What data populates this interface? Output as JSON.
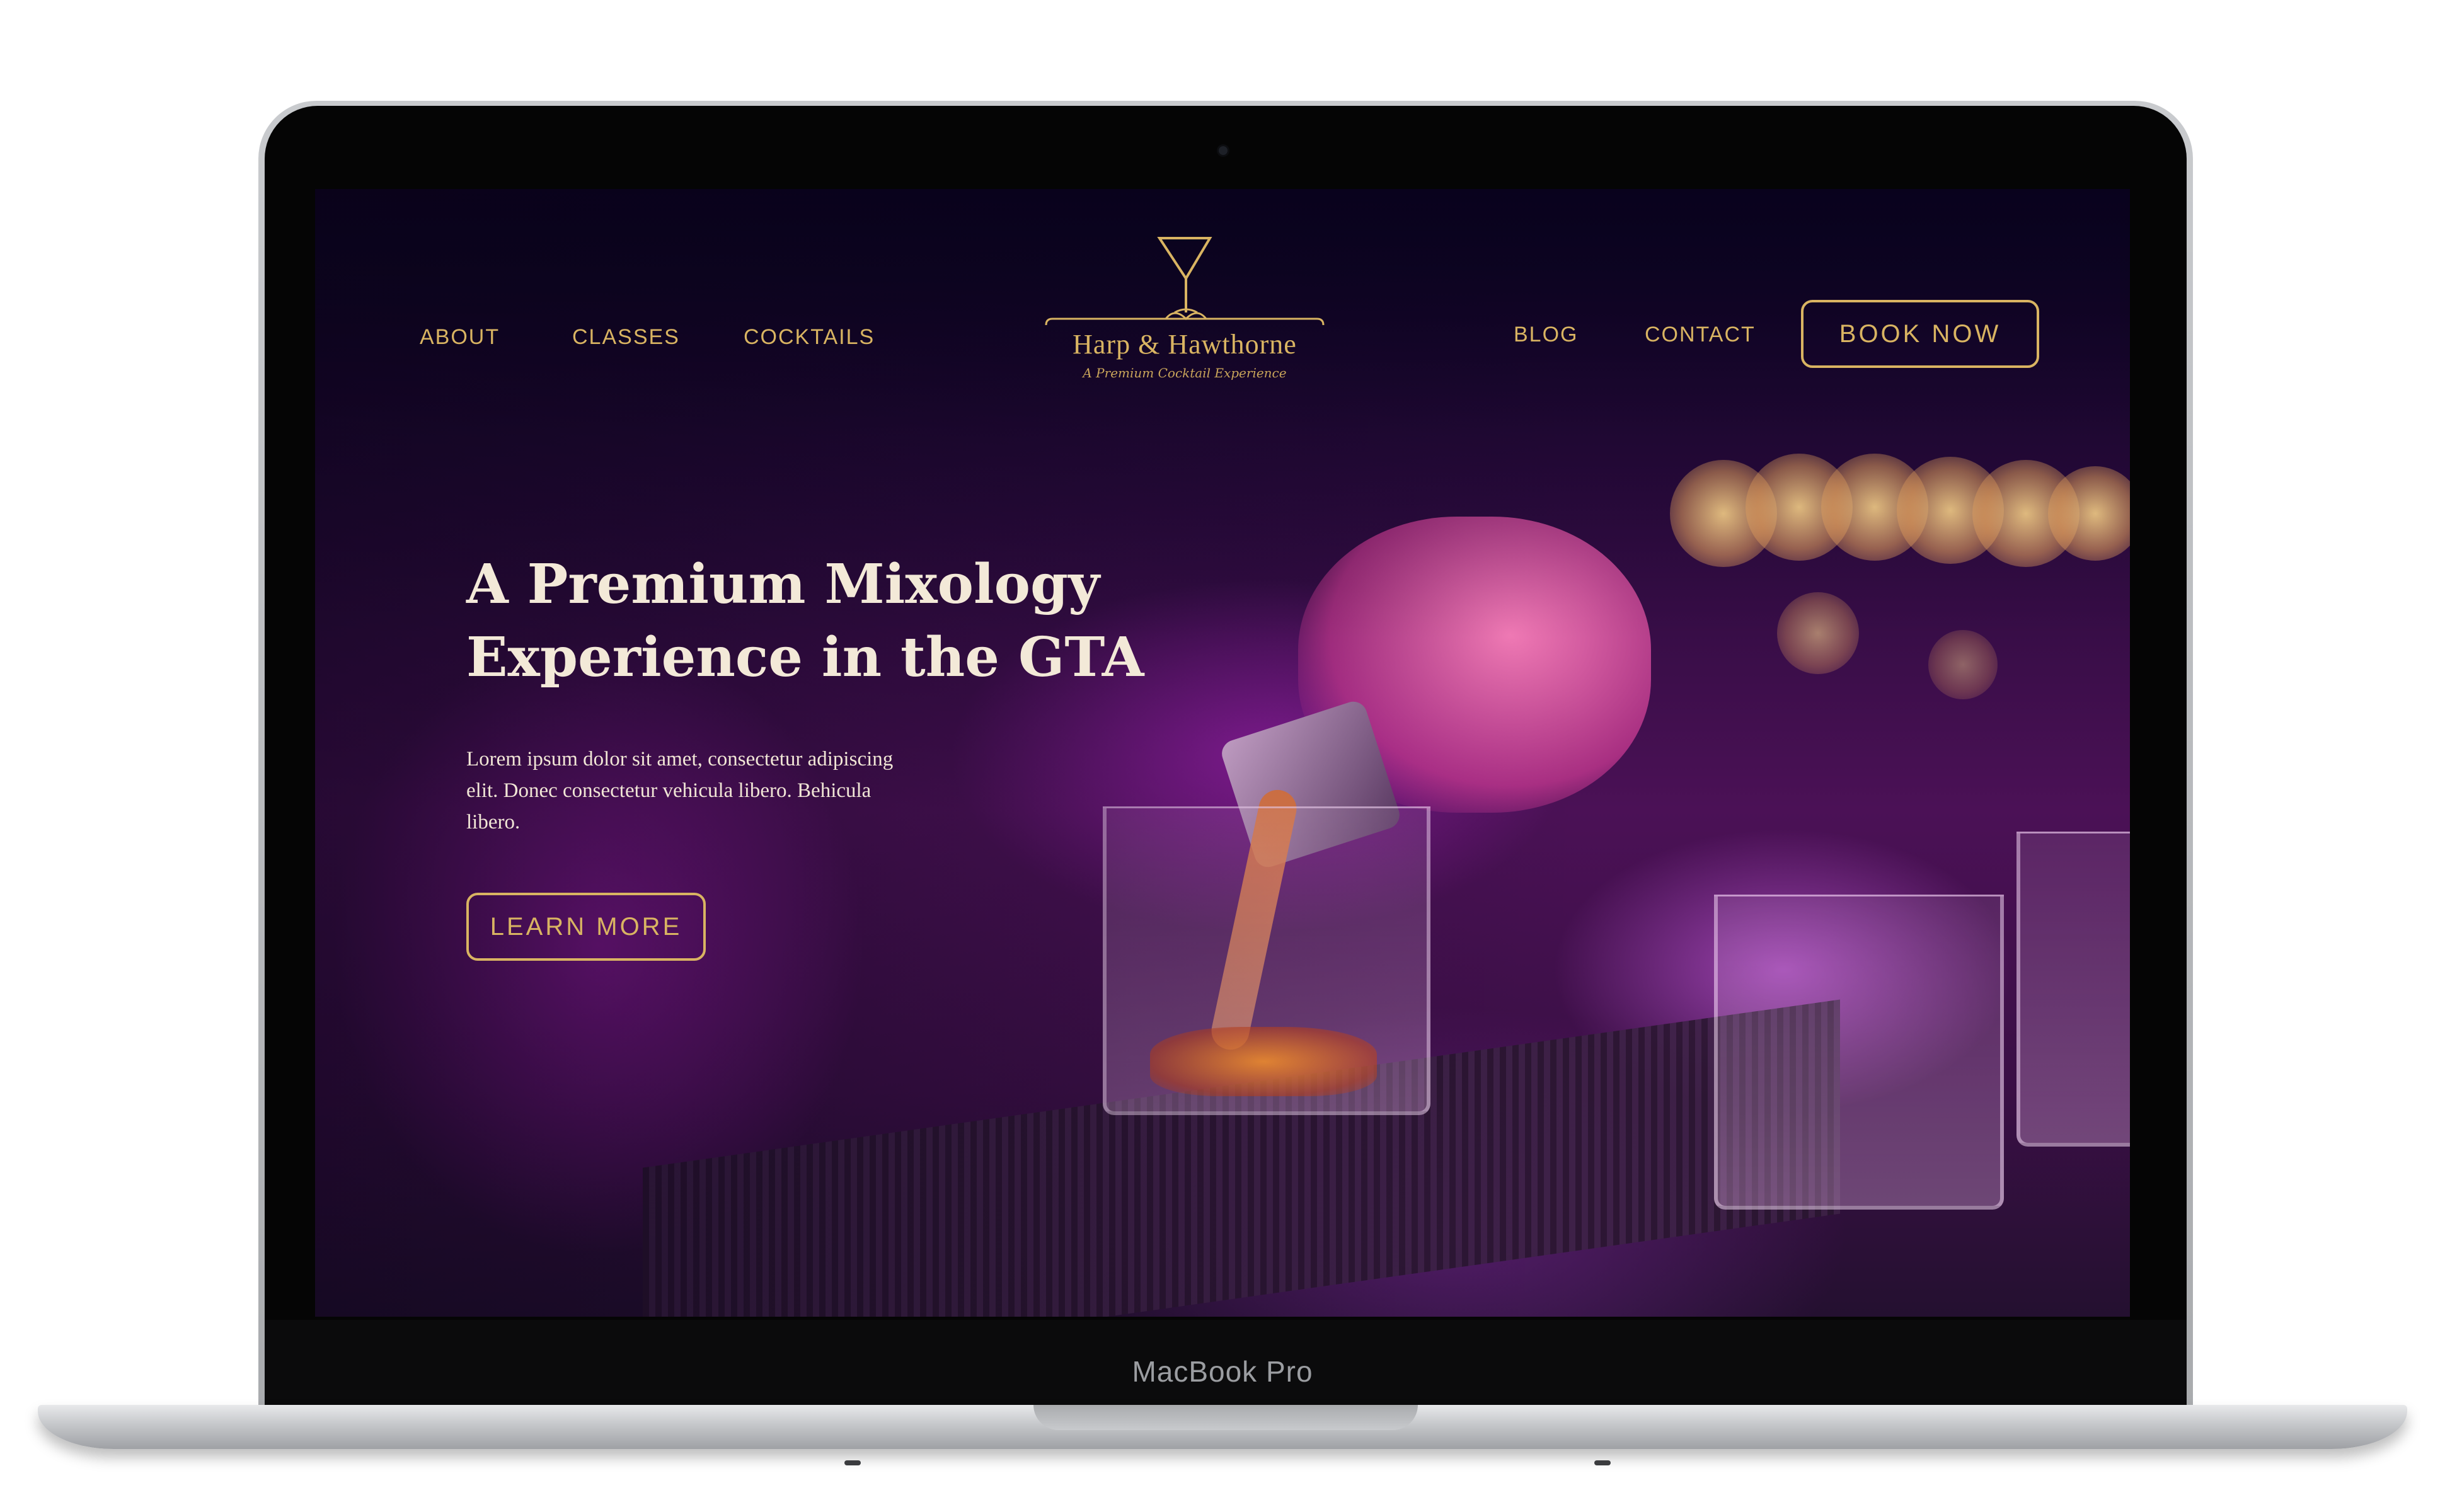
{
  "device": {
    "label": "MacBook Pro"
  },
  "header": {
    "nav_left": [
      {
        "label": "ABOUT"
      },
      {
        "label": "CLASSES"
      },
      {
        "label": "COCKTAILS"
      }
    ],
    "nav_right": [
      {
        "label": "BLOG"
      },
      {
        "label": "CONTACT"
      }
    ],
    "logo": {
      "wordmark": "Harp & Hawthorne",
      "tagline": "A Premium Cocktail Experience"
    },
    "book_now_label": "BOOK NOW"
  },
  "hero": {
    "heading_line1": "A Premium Mixology",
    "heading_line2": "Experience in the GTA",
    "body": "Lorem ipsum dolor sit amet, consectetur adipiscing elit. Donec consectetur vehicula libero. Behicula libero.",
    "cta_label": "LEARN MORE"
  },
  "colors": {
    "accent_gold": "#d9b462",
    "heading_cream": "#f3e9d8",
    "background_purple": "#4b1156"
  },
  "icons": {
    "logo_emblem": "martini-glass-icon"
  }
}
